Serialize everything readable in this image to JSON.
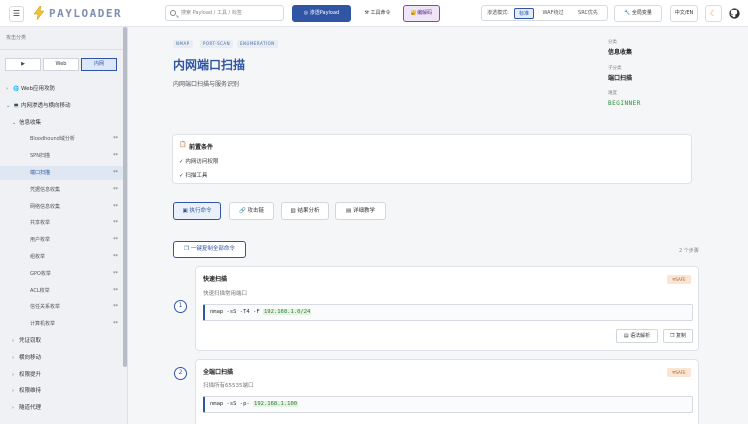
{
  "topbar": {
    "menu_icon": "☰",
    "logo_icon": "lightning-icon",
    "logo_text": "PAYLOADER",
    "search_placeholder": "搜索 Payload / 工具 / 标签",
    "payload_btn": "渗透Payload",
    "tools_btn": "工具命令",
    "codec_btn": "编解码",
    "mode_label": "渗透模式:",
    "modes": [
      "标准",
      "WAF绕过",
      "SRC优先"
    ],
    "active_mode": "标准",
    "vars_btn": "全局变量",
    "lang_btn": "中文/EN",
    "theme_icon": "☾",
    "github_icon": "github-icon"
  },
  "sidebar": {
    "title": "攻击分类",
    "tabs": [
      "▶",
      "Web",
      "内网"
    ],
    "active_tab": "内网",
    "items": [
      {
        "label": "Web应用攻防",
        "level": 0,
        "arrow": "›",
        "icon": "🌐",
        "badge": ""
      },
      {
        "label": "内网渗透与横向移动",
        "level": 0,
        "arrow": "⌄",
        "icon": "💻",
        "badge": ""
      },
      {
        "label": "信息收集",
        "level": 1,
        "arrow": "⌄",
        "icon": "",
        "badge": ""
      },
      {
        "label": "Bloodhound域分析",
        "level": 2,
        "arrow": "",
        "icon": "",
        "badge": "**"
      },
      {
        "label": "SPN扫描",
        "level": 2,
        "arrow": "",
        "icon": "",
        "badge": "**"
      },
      {
        "label": "端口扫描",
        "level": 2,
        "arrow": "",
        "icon": "",
        "badge": "**"
      },
      {
        "label": "凭据信息收集",
        "level": 2,
        "arrow": "",
        "icon": "",
        "badge": "**"
      },
      {
        "label": "网络信息收集",
        "level": 2,
        "arrow": "",
        "icon": "",
        "badge": "**"
      },
      {
        "label": "共享枚举",
        "level": 2,
        "arrow": "",
        "icon": "",
        "badge": "**"
      },
      {
        "label": "用户枚举",
        "level": 2,
        "arrow": "",
        "icon": "",
        "badge": "**"
      },
      {
        "label": "组枚举",
        "level": 2,
        "arrow": "",
        "icon": "",
        "badge": "**"
      },
      {
        "label": "GPO枚举",
        "level": 2,
        "arrow": "",
        "icon": "",
        "badge": "**"
      },
      {
        "label": "ACL枚举",
        "level": 2,
        "arrow": "",
        "icon": "",
        "badge": "**"
      },
      {
        "label": "信任关系枚举",
        "level": 2,
        "arrow": "",
        "icon": "",
        "badge": "**"
      },
      {
        "label": "计算机枚举",
        "level": 2,
        "arrow": "",
        "icon": "",
        "badge": "**"
      },
      {
        "label": "凭证窃取",
        "level": 1,
        "arrow": "›",
        "icon": "",
        "badge": ""
      },
      {
        "label": "横向移动",
        "level": 1,
        "arrow": "›",
        "icon": "",
        "badge": ""
      },
      {
        "label": "权限提升",
        "level": 1,
        "arrow": "›",
        "icon": "",
        "badge": ""
      },
      {
        "label": "权限维持",
        "level": 1,
        "arrow": "›",
        "icon": "",
        "badge": ""
      },
      {
        "label": "隧道代理",
        "level": 1,
        "arrow": "›",
        "icon": "",
        "badge": ""
      }
    ],
    "selected_index": 5
  },
  "main": {
    "tags": [
      "NMAP",
      "PORT-SCAN",
      "ENUMERATION"
    ],
    "title": "内网端口扫描",
    "subtitle": "内网端口扫描与服务识别",
    "meta": {
      "category_label": "分类",
      "category_value": "信息收集",
      "subcategory_label": "子分类",
      "subcategory_value": "端口扫描",
      "level_label": "难度",
      "level_value": "BEGINNER"
    },
    "prereq": {
      "title": "前置条件",
      "items": [
        "内网访问权限",
        "扫描工具"
      ]
    },
    "actions": [
      "执行命令",
      "攻击链",
      "结果分析",
      "详细教学"
    ],
    "active_action": "执行命令",
    "copy_all": "一键复制全部命令",
    "step_count": "2 个步骤",
    "steps": [
      {
        "num": "1",
        "title": "快速扫描",
        "desc": "快速扫描常用端口",
        "badge": "SAFE",
        "cmd_prefix": "nmap -sS -T4 -F ",
        "cmd_target": "192.168.1.0/24",
        "btn_explain": "语法解析",
        "btn_copy": "复制"
      },
      {
        "num": "2",
        "title": "全端口扫描",
        "desc": "扫描所有65535端口",
        "badge": "SAFE",
        "cmd_prefix": "nmap -sS -p- ",
        "cmd_target": "192.168.1.100",
        "btn_explain": "",
        "btn_copy": ""
      }
    ]
  }
}
